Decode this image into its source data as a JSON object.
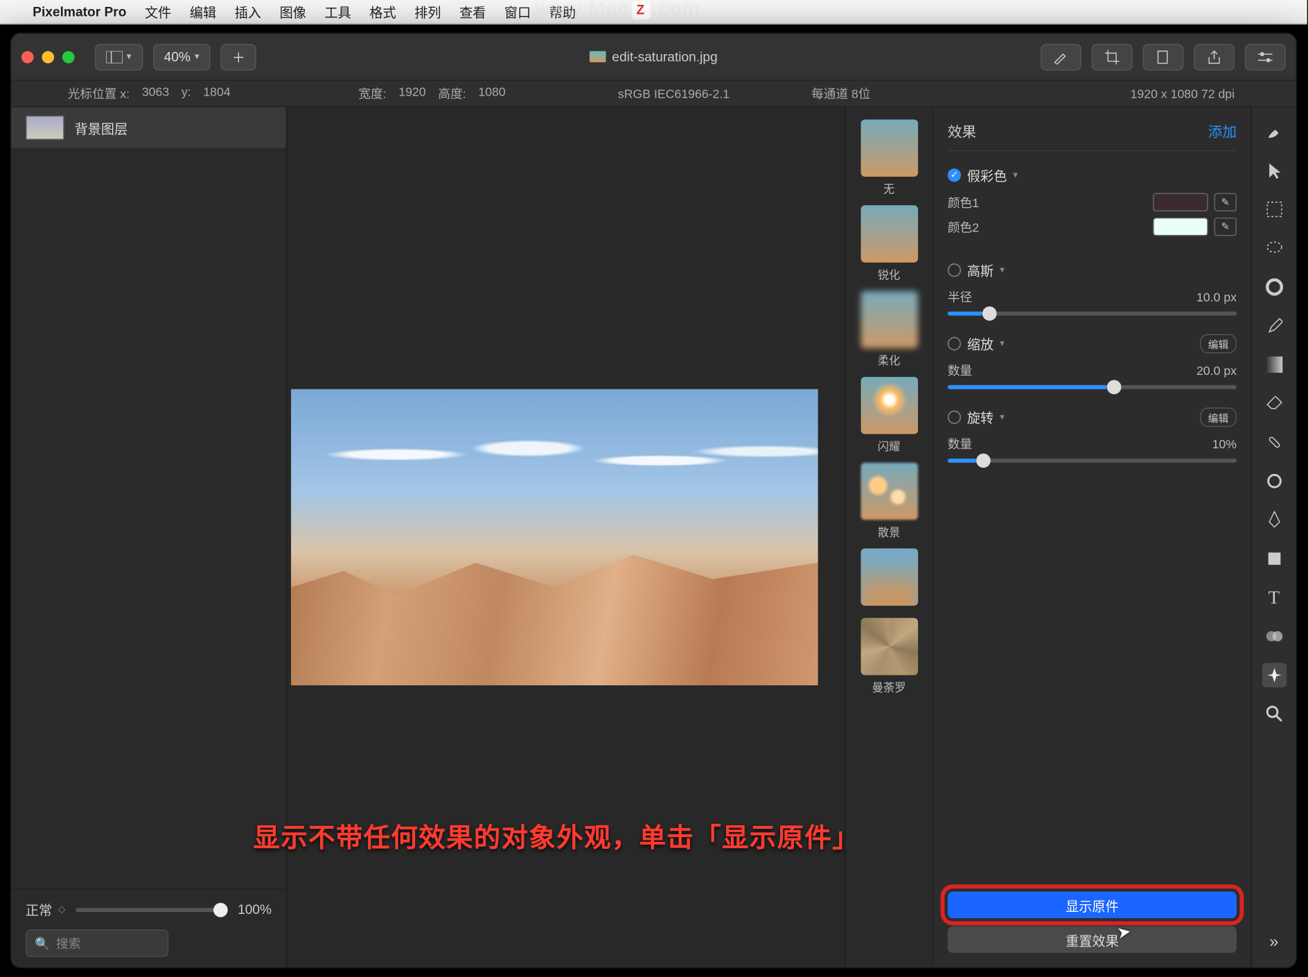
{
  "menubar": {
    "app": "Pixelmator Pro",
    "items": [
      "文件",
      "编辑",
      "插入",
      "图像",
      "工具",
      "格式",
      "排列",
      "查看",
      "窗口",
      "帮助"
    ]
  },
  "watermark": "www.MacZ.com",
  "toolbar": {
    "zoom": "40%",
    "title": "edit-saturation.jpg"
  },
  "infobar": {
    "cursor_label": "光标位置 x:",
    "cursor_x": "3063",
    "cursor_y_label": "y:",
    "cursor_y": "1804",
    "width_label": "宽度:",
    "width": "1920",
    "height_label": "高度:",
    "height": "1080",
    "colorspace": "sRGB IEC61966-2.1",
    "depth": "每通道 8位",
    "dims": "1920 x 1080 72 dpi"
  },
  "layers": {
    "item": "背景图层",
    "blend": "正常",
    "opacity": "100%",
    "search_ph": "搜索"
  },
  "fx": {
    "header": "效果",
    "add": "添加",
    "thumbs": [
      "无",
      "锐化",
      "柔化",
      "闪耀",
      "散景",
      "",
      "曼荼罗"
    ],
    "groups": {
      "falsecolor": {
        "title": "假彩色",
        "c1": "颜色1",
        "c2": "颜色2",
        "swatch1": "#3b2a30",
        "swatch2": "#e9fff8"
      },
      "gauss": {
        "title": "高斯",
        "radius_label": "半径",
        "radius_val": "10.0 px",
        "pct": 12
      },
      "zoom": {
        "title": "缩放",
        "edit": "编辑",
        "amt_label": "数量",
        "amt_val": "20.0 px",
        "pct": 55
      },
      "spin": {
        "title": "旋转",
        "edit": "编辑",
        "amt_label": "数量",
        "amt_val": "10%",
        "pct": 10
      }
    },
    "show_original": "显示原件",
    "reset": "重置效果"
  },
  "caption": "显示不带任何效果的对象外观，单击「显示原件」"
}
